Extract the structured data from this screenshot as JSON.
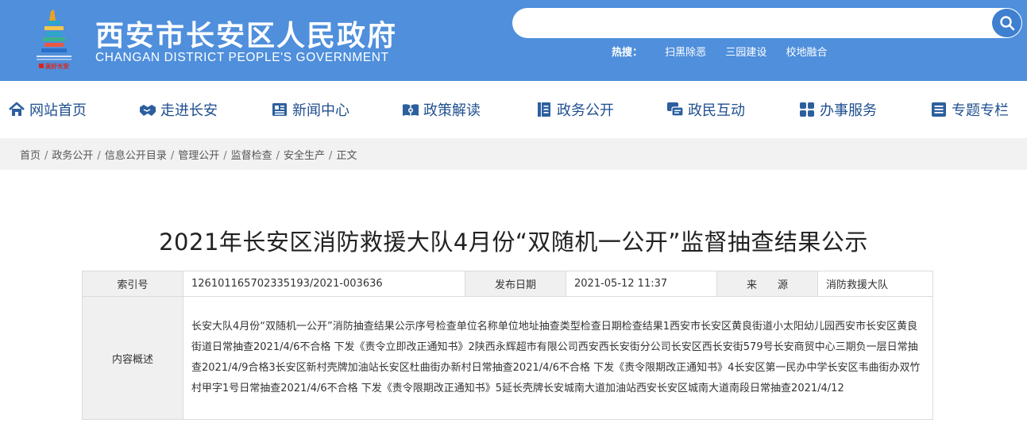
{
  "header": {
    "title": "西安市长安区人民政府",
    "subtitle": "CHANGAN DISTRICT PEOPLE'S GOVERNMENT",
    "logo_caption": "美好长安",
    "search_placeholder": "",
    "hot_label": "热搜：",
    "hot_links": [
      "扫黑除恶",
      "三园建设",
      "校地融合"
    ],
    "brand_color": "#4f8fdc"
  },
  "nav": {
    "items": [
      {
        "label": "网站首页",
        "icon": "home-icon"
      },
      {
        "label": "走进长安",
        "icon": "handshake-icon"
      },
      {
        "label": "新闻中心",
        "icon": "newspaper-icon"
      },
      {
        "label": "政策解读",
        "icon": "book-icon"
      },
      {
        "label": "政务公开",
        "icon": "document-icon"
      },
      {
        "label": "政民互动",
        "icon": "chat-icon"
      },
      {
        "label": "办事服务",
        "icon": "grid-icon"
      },
      {
        "label": "专题专栏",
        "icon": "list-icon"
      }
    ],
    "color": "#1f4f8f"
  },
  "breadcrumb": {
    "items": [
      "首页",
      "政务公开",
      "信息公开目录",
      "管理公开",
      "监督检查",
      "安全生产",
      "正文"
    ],
    "separator": "/"
  },
  "article": {
    "title": "2021年长安区消防救援大队4月份“双随机一公开”监督抽查结果公示"
  },
  "info": {
    "index_label": "索引号",
    "index_value": "126101165702335193/2021-003636",
    "date_label": "发布日期",
    "date_value": "2021-05-12 11:37",
    "source_label": "来　　源",
    "source_value": "消防救援大队",
    "summary_label": "内容概述",
    "summary_value": "长安大队4月份“双随机一公开”消防抽查结果公示序号检查单位名称单位地址抽查类型检查日期检查结果1西安市长安区黄良街道小太阳幼儿园西安市长安区黄良街道日常抽查2021/4/6不合格 下发《责令立即改正通知书》2陕西永辉超市有限公司西安西长安街分公司长安区西长安街579号长安商贸中心三期负一层日常抽查2021/4/9合格3长安区新村壳牌加油站长安区杜曲街办新村日常抽查2021/4/6不合格 下发《责令限期改正通知书》4长安区第一民办中学长安区韦曲街办双竹村甲字1号日常抽查2021/4/6不合格 下发《责令限期改正通知书》5延长壳牌长安城南大道加油站西安长安区城南大道南段日常抽查2021/4/12"
  }
}
